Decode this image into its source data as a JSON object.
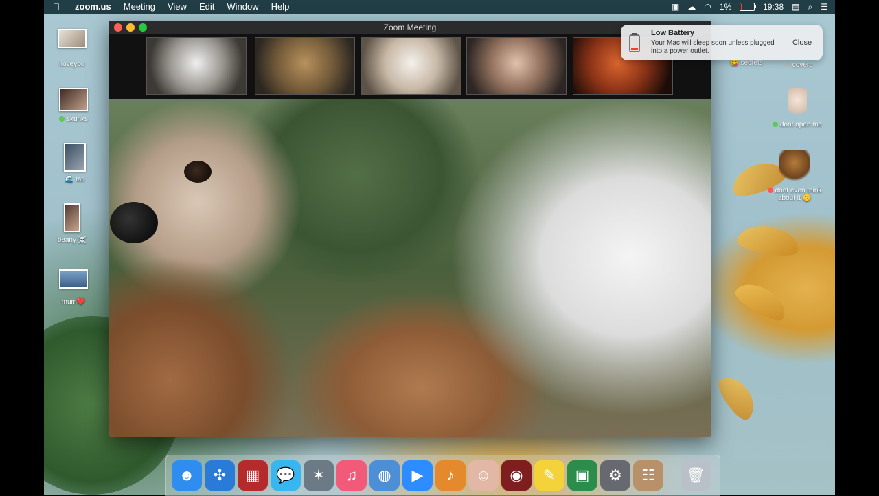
{
  "menubar": {
    "app_name": "zoom.us",
    "menus": [
      "Meeting",
      "View",
      "Edit",
      "Window",
      "Help"
    ],
    "battery_percent": "1%",
    "clock": "19:38"
  },
  "desktop_left": [
    {
      "label": "iloveyou"
    },
    {
      "label": "skunks",
      "dot_color": "#5fc65a"
    },
    {
      "label": "tati",
      "emoji": "🌊"
    },
    {
      "label": "beany",
      "emoji": "☠️"
    },
    {
      "label": "mum",
      "emoji": "❤️"
    }
  ],
  "desktop_right": [
    {
      "label": "secrets",
      "emoji": "😋"
    },
    {
      "label": "covers",
      "dot_color": "#bbbbbb"
    },
    {
      "label": "dont open me",
      "dot_color": "#5fc65a"
    },
    {
      "label": "dont even think about it",
      "emoji": "🤫",
      "dot_color": "#ff5555"
    }
  ],
  "zoom": {
    "window_title": "Zoom Meeting"
  },
  "notification": {
    "title": "Low Battery",
    "message": "Your Mac will sleep soon unless plugged into a power outlet.",
    "close_label": "Close"
  },
  "dock": {
    "apps": [
      {
        "name": "finder",
        "color": "#2f8df0",
        "glyph": "☻"
      },
      {
        "name": "safari",
        "color": "#2a7bd8",
        "glyph": "✣"
      },
      {
        "name": "photo-booth",
        "color": "#b52a2a",
        "glyph": "▦"
      },
      {
        "name": "messages",
        "color": "#38b6f0",
        "glyph": "💬"
      },
      {
        "name": "launchpad",
        "color": "#6c7a86",
        "glyph": "✶"
      },
      {
        "name": "music",
        "color": "#f25a7a",
        "glyph": "♫"
      },
      {
        "name": "seal-app",
        "color": "#4d8fd6",
        "glyph": "◍"
      },
      {
        "name": "zoom",
        "color": "#2d8cff",
        "glyph": "▶"
      },
      {
        "name": "garageband",
        "color": "#e58a2c",
        "glyph": "♪"
      },
      {
        "name": "face-app",
        "color": "#e3b7a6",
        "glyph": "☺"
      },
      {
        "name": "photo-booth-2",
        "color": "#7f1e1e",
        "glyph": "◉"
      },
      {
        "name": "stickies",
        "color": "#f3d23a",
        "glyph": "✎"
      },
      {
        "name": "preview",
        "color": "#2b8c4c",
        "glyph": "▣"
      },
      {
        "name": "system-preferences",
        "color": "#666a70",
        "glyph": "⚙"
      },
      {
        "name": "contacts",
        "color": "#b8916a",
        "glyph": "☷"
      },
      {
        "name": "trash",
        "color": "#b9c0c7",
        "glyph": "🗑"
      }
    ]
  }
}
